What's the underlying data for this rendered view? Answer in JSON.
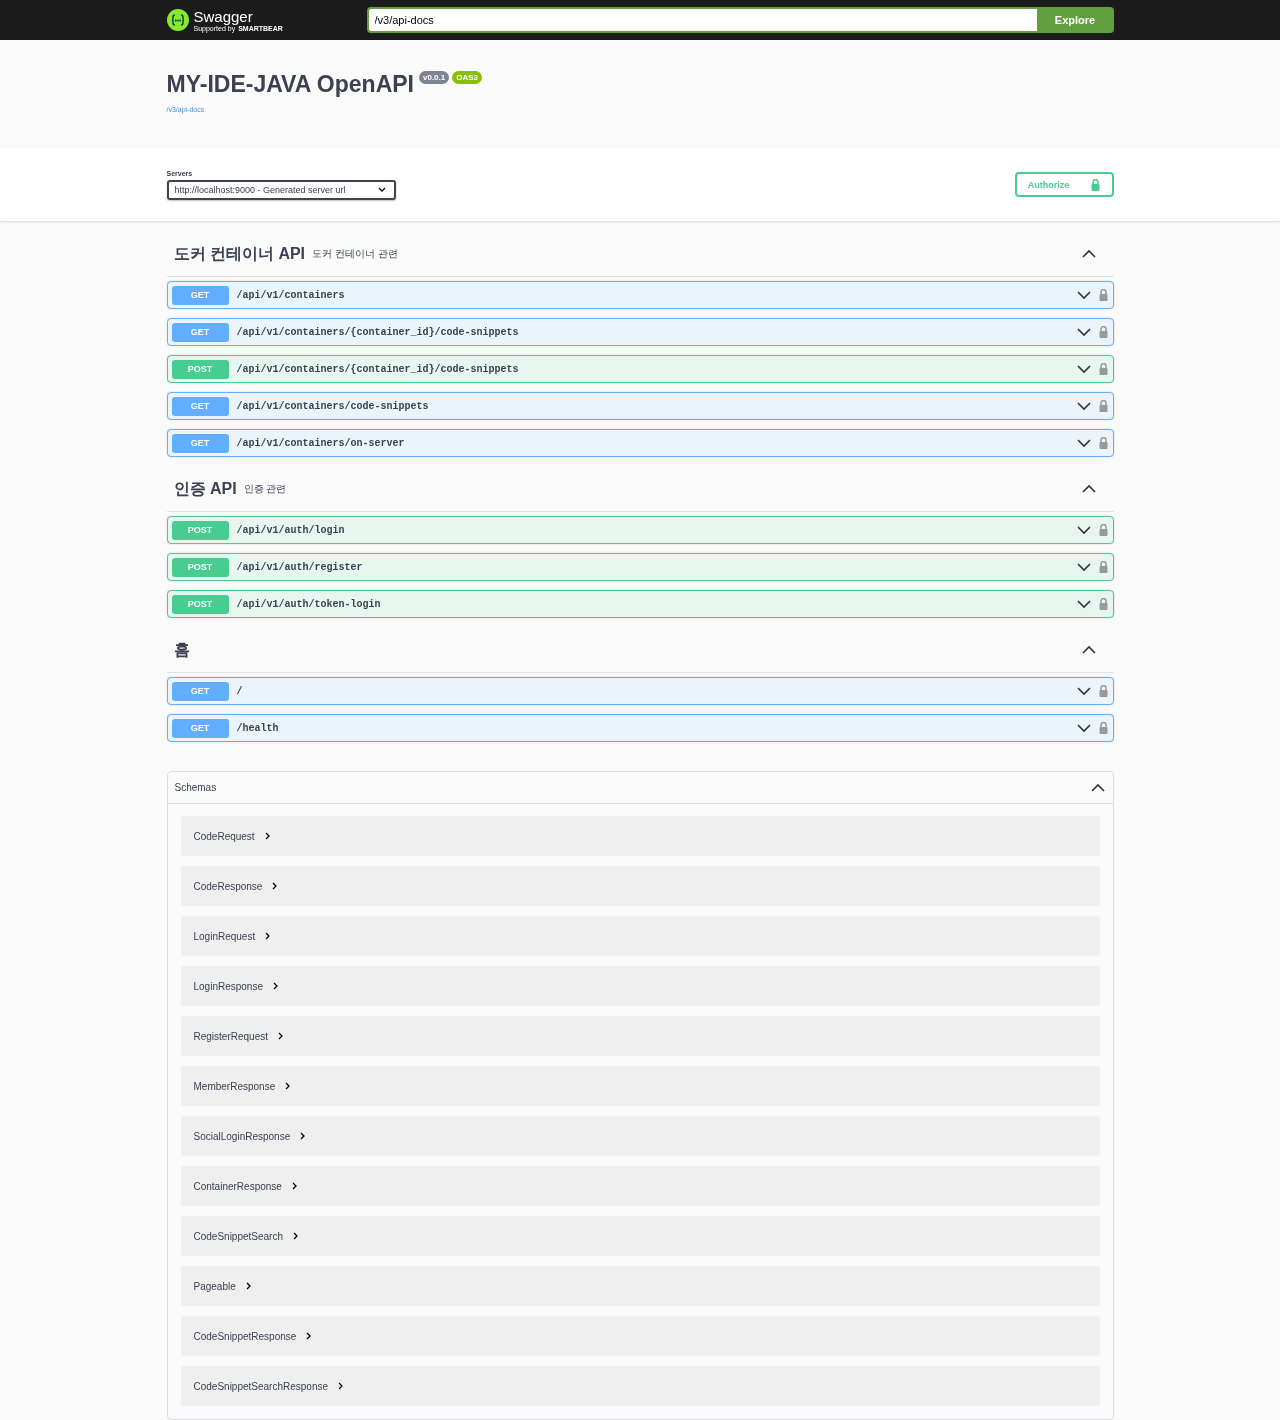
{
  "topbar": {
    "brand": "Swagger",
    "brand_sub_prefix": "Supported by",
    "brand_sub": "SMARTBEAR",
    "url": "/v3/api-docs",
    "explore": "Explore"
  },
  "info": {
    "title": "MY-IDE-JAVA OpenAPI",
    "version": "v0.0.1",
    "oas": "OAS3",
    "link": "/v3/api-docs"
  },
  "servers": {
    "label": "Servers",
    "value": "http://localhost:9000 - Generated server url",
    "authorize": "Authorize"
  },
  "tags": [
    {
      "name": "도커 컨테이너 API",
      "description": "도커 컨테이너 관련",
      "expanded": true,
      "operations": [
        {
          "kind": "get",
          "method": "GET",
          "path": "/api/v1/containers"
        },
        {
          "kind": "get",
          "method": "GET",
          "path": "/api/v1/containers/{container_id}/code-snippets"
        },
        {
          "kind": "post",
          "method": "POST",
          "path": "/api/v1/containers/{container_id}/code-snippets"
        },
        {
          "kind": "get",
          "method": "GET",
          "path": "/api/v1/containers/code-snippets"
        },
        {
          "kind": "get",
          "method": "GET",
          "path": "/api/v1/containers/on-server"
        }
      ]
    },
    {
      "name": "인증 API",
      "description": "인증 관련",
      "expanded": true,
      "operations": [
        {
          "kind": "post",
          "method": "POST",
          "path": "/api/v1/auth/login"
        },
        {
          "kind": "post",
          "method": "POST",
          "path": "/api/v1/auth/register"
        },
        {
          "kind": "post",
          "method": "POST",
          "path": "/api/v1/auth/token-login"
        }
      ]
    },
    {
      "name": "홈",
      "expanded": true,
      "operations": [
        {
          "kind": "get",
          "method": "GET",
          "path": "/"
        },
        {
          "kind": "get",
          "method": "GET",
          "path": "/health"
        }
      ]
    }
  ],
  "schemas": {
    "title": "Schemas",
    "expanded": true,
    "items": [
      "CodeRequest",
      "CodeResponse",
      "LoginRequest",
      "LoginResponse",
      "RegisterRequest",
      "MemberResponse",
      "SocialLoginResponse",
      "ContainerResponse",
      "CodeSnippetSearch",
      "Pageable",
      "CodeSnippetResponse",
      "CodeSnippetSearchResponse"
    ]
  }
}
